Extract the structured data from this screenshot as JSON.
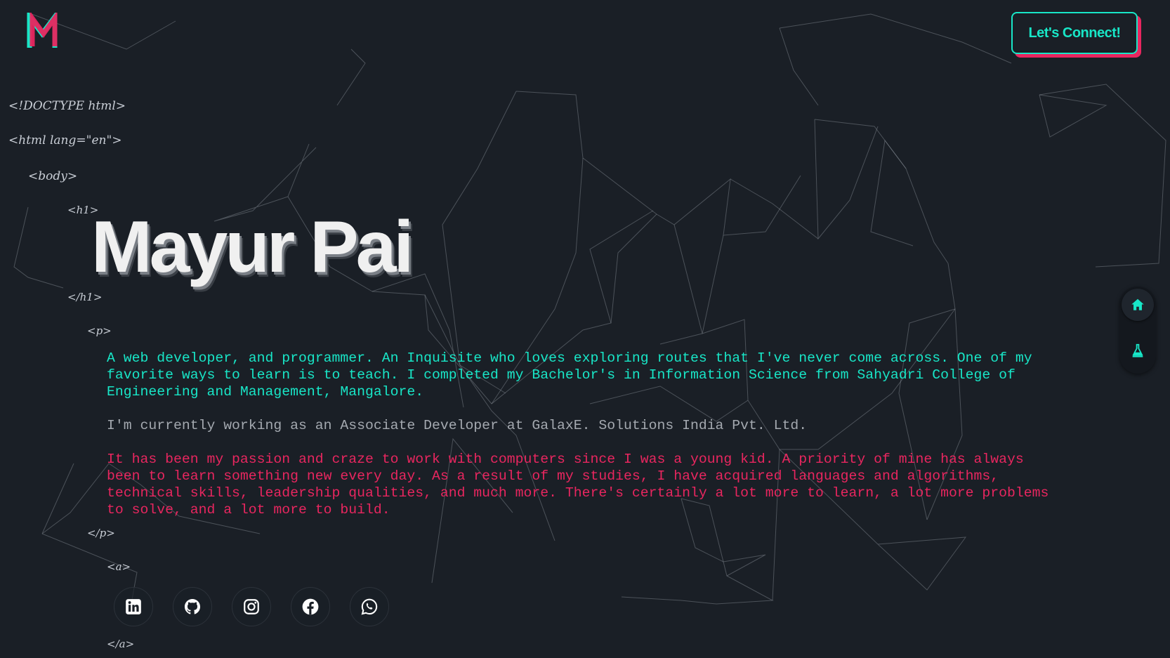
{
  "brand": {
    "logo_letter": "M",
    "primary_color": "#18e6c7",
    "accent_color": "#e8265f",
    "background_color": "#1a1f26"
  },
  "header": {
    "connect_label": "Let's Connect!"
  },
  "code_tags": {
    "doctype": "<!DOCTYPE html>",
    "html": "<html lang=\"en\">",
    "body": "<body>",
    "h1_open": "<h1>",
    "h1_close": "</h1>",
    "p_open": "<p>",
    "p_close": "</p>",
    "a_open": "<a>",
    "a_close": "</a>"
  },
  "hero": {
    "name": "Mayur Pai"
  },
  "about": {
    "paragraph_1": "A web developer, and programmer. An Inquisite who loves exploring routes that I've never come across. One of my favorite ways to learn is to teach. I completed my Bachelor's in Information Science from Sahyadri College of Engineering and Management, Mangalore.",
    "paragraph_2": "I'm currently working as an Associate Developer at GalaxE. Solutions India Pvt. Ltd.",
    "paragraph_3": "It has been my passion and craze to work with computers since I was a young kid. A priority of mine has always been to learn something new every day. As a result of my studies, I have acquired languages and algorithms, technical skills, leadership qualities, and much more. There's certainly a lot more to learn, a lot more problems to solve, and a lot more to build."
  },
  "socials": [
    {
      "icon": "linkedin-icon"
    },
    {
      "icon": "github-icon"
    },
    {
      "icon": "instagram-icon"
    },
    {
      "icon": "facebook-icon"
    },
    {
      "icon": "whatsapp-icon"
    }
  ],
  "side_nav": [
    {
      "icon": "home-icon",
      "active": true
    },
    {
      "icon": "flask-icon",
      "active": false
    }
  ]
}
